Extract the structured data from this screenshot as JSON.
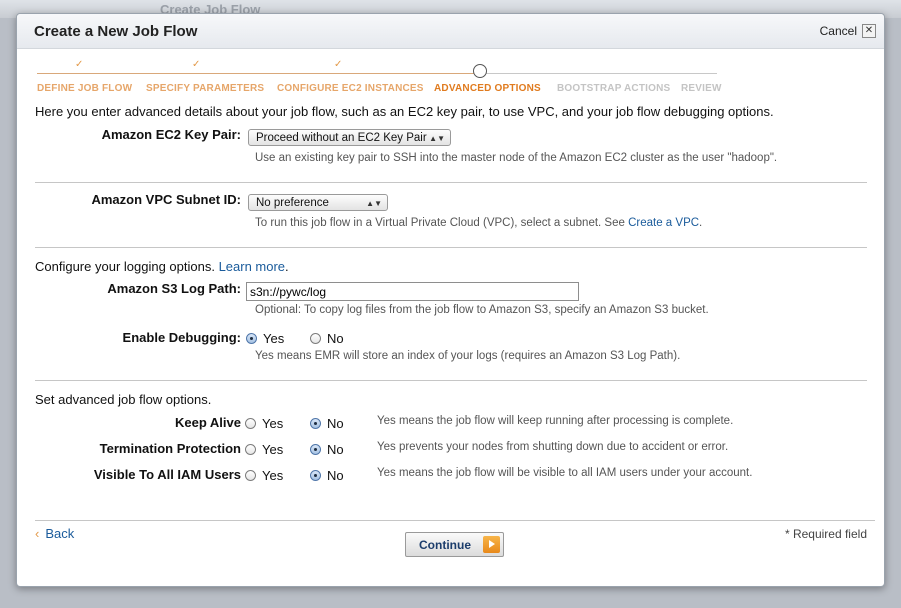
{
  "background": {
    "ghost_title": "Create Job Flow"
  },
  "dialog": {
    "title": "Create a New Job Flow",
    "cancel_label": "Cancel",
    "close_glyph": "✕"
  },
  "wizard": {
    "tick": "✓",
    "steps": [
      {
        "label": "DEFINE JOB FLOW",
        "state": "done"
      },
      {
        "label": "SPECIFY PARAMETERS",
        "state": "done"
      },
      {
        "label": "CONFIGURE EC2 INSTANCES",
        "state": "done"
      },
      {
        "label": "ADVANCED OPTIONS",
        "state": "current"
      },
      {
        "label": "BOOTSTRAP ACTIONS",
        "state": "todo"
      },
      {
        "label": "REVIEW",
        "state": "todo"
      }
    ]
  },
  "intro": "Here you enter advanced details about your job flow, such as an EC2 key pair, to use VPC, and your job flow debugging options.",
  "key_pair": {
    "label": "Amazon EC2 Key Pair:",
    "value": "Proceed without an EC2 Key Pair",
    "help": "Use an existing key pair to SSH into the master node of the Amazon EC2 cluster as the user \"hadoop\"."
  },
  "vpc": {
    "label": "Amazon VPC Subnet ID:",
    "value": "No preference",
    "help": "To run this job flow in a Virtual Private Cloud (VPC), select a subnet. See ",
    "help_link": "Create a VPC",
    "help_end": "."
  },
  "logging": {
    "intro": "Configure your logging options. ",
    "learn_more": "Learn more",
    "learn_more_end": ".",
    "log_path_label": "Amazon S3 Log Path:",
    "log_path_value": "s3n://pywc/log",
    "log_path_help": "Optional: To copy log files from the job flow to Amazon S3, specify an Amazon S3 bucket.",
    "debug_label": "Enable Debugging:",
    "debug_yes": "Yes",
    "debug_no": "No",
    "debug_selected": "Yes",
    "debug_help": "Yes means EMR will store an index of your logs (requires an Amazon S3 Log Path)."
  },
  "advanced": {
    "intro": "Set advanced job flow options.",
    "rows": [
      {
        "label": "Keep Alive",
        "yes": "Yes",
        "no": "No",
        "selected": "No",
        "help": "Yes means the job flow will keep running after processing is complete."
      },
      {
        "label": "Termination Protection",
        "yes": "Yes",
        "no": "No",
        "selected": "No",
        "help": "Yes prevents your nodes from shutting down due to accident or error."
      },
      {
        "label": "Visible To All IAM Users",
        "yes": "Yes",
        "no": "No",
        "selected": "No",
        "help": "Yes means the job flow will be visible to all IAM users under your account."
      }
    ]
  },
  "footer": {
    "back_label": "Back",
    "back_chevron": "‹",
    "continue_label": "Continue",
    "required_note": "* Required field"
  },
  "colors": {
    "accent": "#e07b1f",
    "link": "#1a5b9b",
    "button_text": "#1c3d6c"
  }
}
